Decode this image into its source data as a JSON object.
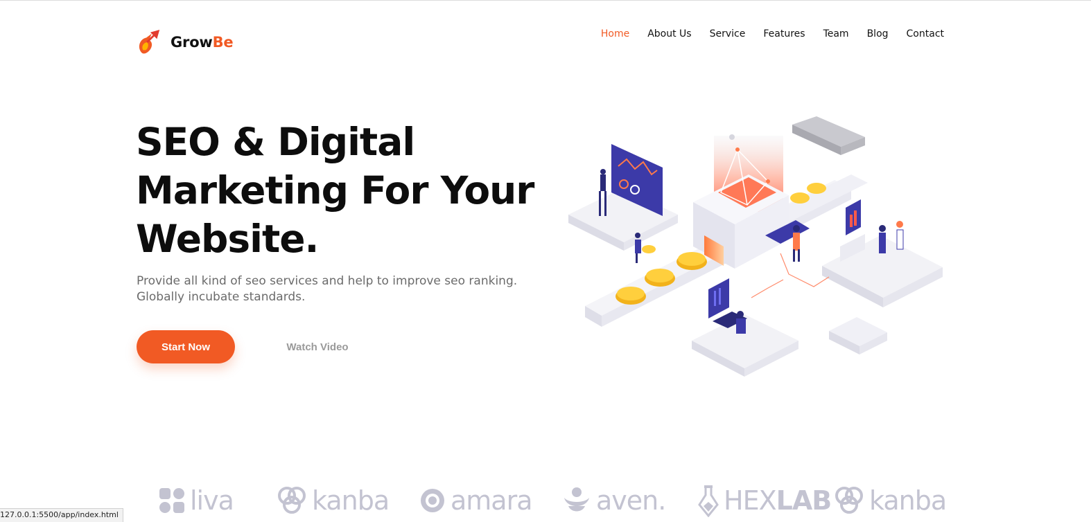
{
  "brand": {
    "name_main": "Grow",
    "name_accent": "Be",
    "accent_color": "#f15a24"
  },
  "nav": {
    "items": [
      "Home",
      "About Us",
      "Service",
      "Features",
      "Team",
      "Blog",
      "Contact"
    ],
    "active": "Home"
  },
  "hero": {
    "title_lines": [
      "SEO & Digital",
      "Marketing For Your",
      "Website."
    ],
    "subtitle_lines": [
      "Provide all kind of seo services and help to improve seo ranking.",
      "Globally incubate standards."
    ],
    "primary_button": "Start Now",
    "secondary_button": "Watch Video"
  },
  "partners": [
    "liva",
    "kanba",
    "amara",
    "aven.",
    "HEXLAB",
    "kanba"
  ],
  "partner_hexlab": {
    "part1": "HEX",
    "part2": "LAB"
  },
  "status_bar": {
    "url": "127.0.0.1:5500/app/index.html"
  }
}
